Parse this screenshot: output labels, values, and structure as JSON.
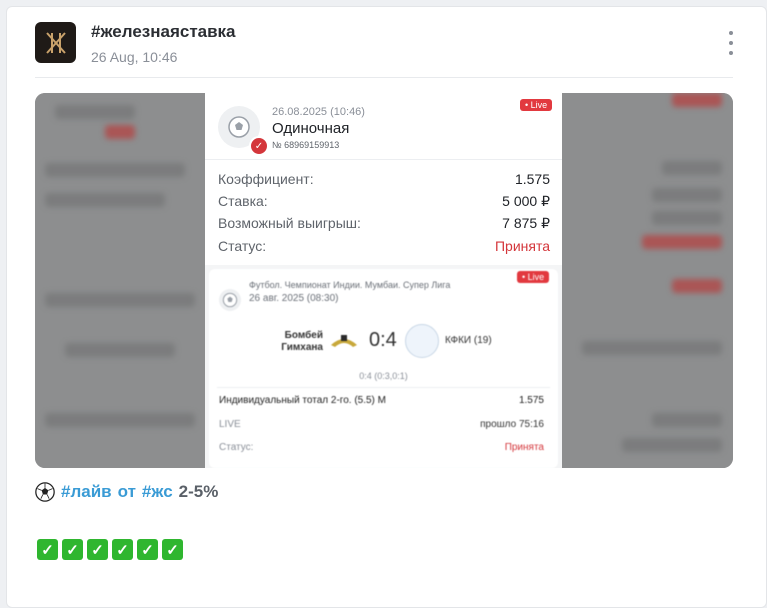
{
  "post": {
    "channel": "#железнаяставка",
    "date": "26 Aug, 10:46",
    "footer": {
      "tag1": "#лайв",
      "mid": "от",
      "tag2": "#жс",
      "range": "2-5%"
    },
    "check_marks": [
      "✓",
      "✓",
      "✓",
      "✓",
      "✓",
      "✓"
    ]
  },
  "bet": {
    "datetime": "26.08.2025 (10:46)",
    "type": "Одиночная",
    "number": "№ 68969159913",
    "live_badge": "Live",
    "rows": [
      {
        "label": "Коэффициент:",
        "value": "1.575"
      },
      {
        "label": "Ставка:",
        "value": "5 000 ₽"
      },
      {
        "label": "Возможный выигрыш:",
        "value": "7 875 ₽"
      },
      {
        "label": "Статус:",
        "value": "Принята"
      }
    ]
  },
  "event": {
    "league": "Футбол. Чемпионат Индии. Мумбаи. Супер Лига",
    "date": "26 авг. 2025 (08:30)",
    "live_badge": "Live",
    "team1": "Бомбей Гимхана",
    "score": "0:4",
    "team2": "КФКИ (19)",
    "halves": "0:4 (0:3,0:1)",
    "market": "Индивидуальный тотал 2-го. (5.5) М",
    "market_odds": "1.575",
    "live_label": "LIVE",
    "elapsed": "прошло 75:16",
    "status_label": "Статус:",
    "status_value": "Принята"
  },
  "colors": {
    "accent": "#3a9bd5",
    "live": "#e2393f",
    "accepted": "#d4363b",
    "check_green": "#2fb62f"
  }
}
